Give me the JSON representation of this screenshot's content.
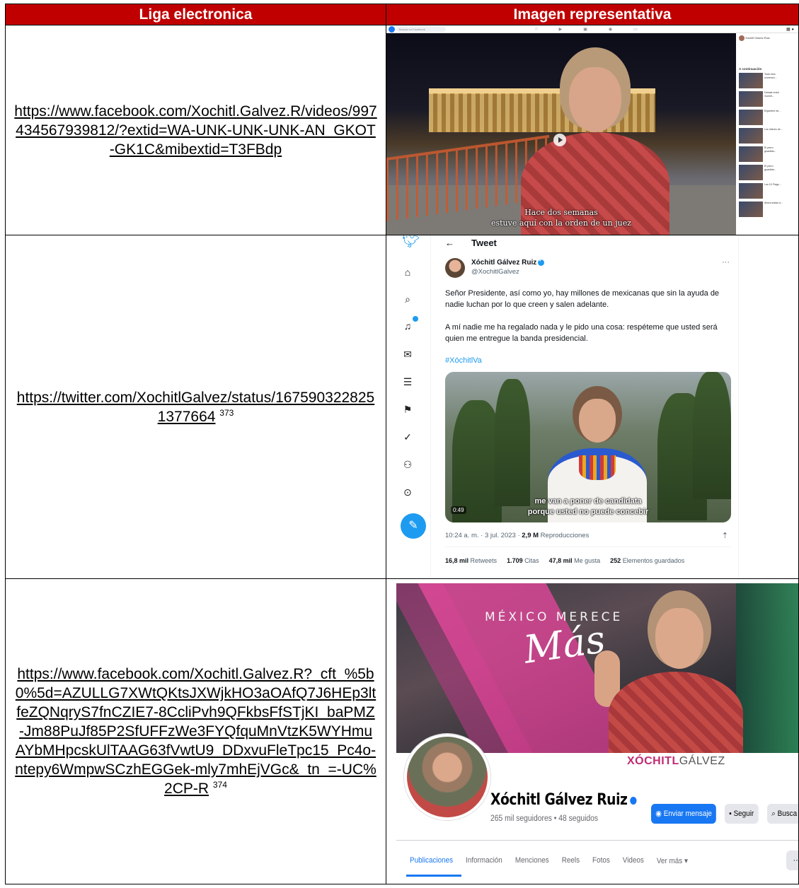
{
  "table": {
    "headers": {
      "link": "Liga electronica",
      "image": "Imagen representativa"
    },
    "rows": [
      {
        "url": "https://www.facebook.com/Xochitl.Galvez.R/videos/997434567939812/?extid=WA-UNK-UNK-UNK-AN_GKOT-GK1C&mibextid=T3FBdp",
        "footnote": ""
      },
      {
        "url": "https://twitter.com/XochitlGalvez/status/1675903228251377664",
        "footnote": "373"
      },
      {
        "url": "https://www.facebook.com/Xochitl.Galvez.R?_cft_%5b0%5d=AZULLG7XWtQKtsJXWjkHO3aOAfQ7J6HEp3ltfeZQNqryS7fnCZIE7-8CcliPvh9QFkbsFfSTjKI_baPMZ-Jm88PuJf85P2SfUFFzWe3FYQfquMnVtzK5WYHmuAYbMHpcskUlTAAG63fVwtU9_DDxvuFleTpc15_Pc4o-ntepy6WmpwSCzhEGGek-mly7mhEjVGc&_tn_=-UC%2CP-R",
        "footnote": "374"
      }
    ]
  },
  "fb_video": {
    "search_placeholder": "Buscar en Facebook",
    "caption_line1": "Hace dos semanas",
    "caption_line2": "estuve aquí con la orden de un juez",
    "side_author": "Xóchitl Gálvez Ruiz",
    "side_heading": "A continuación",
    "side_items": [
      "Todo esto comenzó...",
      "Debate entre Xochitl...",
      "Enjambre de...",
      "Los líderes de...",
      "El perro guardián...",
      "El perro guardián...",
      "Los 10 Flags...",
      "Ahora lustas a..."
    ]
  },
  "tweet": {
    "header": "Tweet",
    "back": "←",
    "name": "Xóchitl Gálvez Ruiz",
    "handle": "@XochitlGalvez",
    "more": "···",
    "paragraph1": "Señor Presidente, así como yo, hay millones de mexicanas que sin la ayuda de nadie luchan por lo que creen y salen adelante.",
    "paragraph2": "A mí nadie me ha regalado nada y le pido una cosa: respéteme que usted será quien me entregue la banda presidencial.",
    "hashtag": "#XóchitlVa",
    "video_duration": "0:49",
    "subtitle_line1": "me van a poner de candidata",
    "subtitle_line2": "porque usted no puede concebir",
    "timestamp": "10:24 a. m. · 3 jul. 2023 · ",
    "views_value": "2,9 M",
    "views_label": " Reproducciones",
    "stats": [
      {
        "value": "16,8 mil",
        "label": " Retweets"
      },
      {
        "value": "1.709",
        "label": " Citas"
      },
      {
        "value": "47,8 mil",
        "label": " Me gusta"
      },
      {
        "value": "252",
        "label": " Elementos guardados"
      }
    ]
  },
  "fb_profile": {
    "slogan_line1": "MÉXICO MERECE",
    "slogan_line2": "Más",
    "brand_first": "XÓCHITL",
    "brand_last": "GÁLVEZ",
    "name": "Xóchitl Gálvez Ruiz",
    "followers": "265 mil seguidores • 48 seguidos",
    "btn_message": "Enviar mensaje",
    "btn_follow": "Seguir",
    "btn_search": "Busca",
    "tabs": [
      "Publicaciones",
      "Información",
      "Menciones",
      "Reels",
      "Fotos",
      "Videos",
      "Ver más ▾"
    ],
    "more": "···"
  },
  "colors": {
    "header_bg": "#c00000",
    "twitter_blue": "#1d9bf0",
    "facebook_blue": "#1877f2"
  }
}
